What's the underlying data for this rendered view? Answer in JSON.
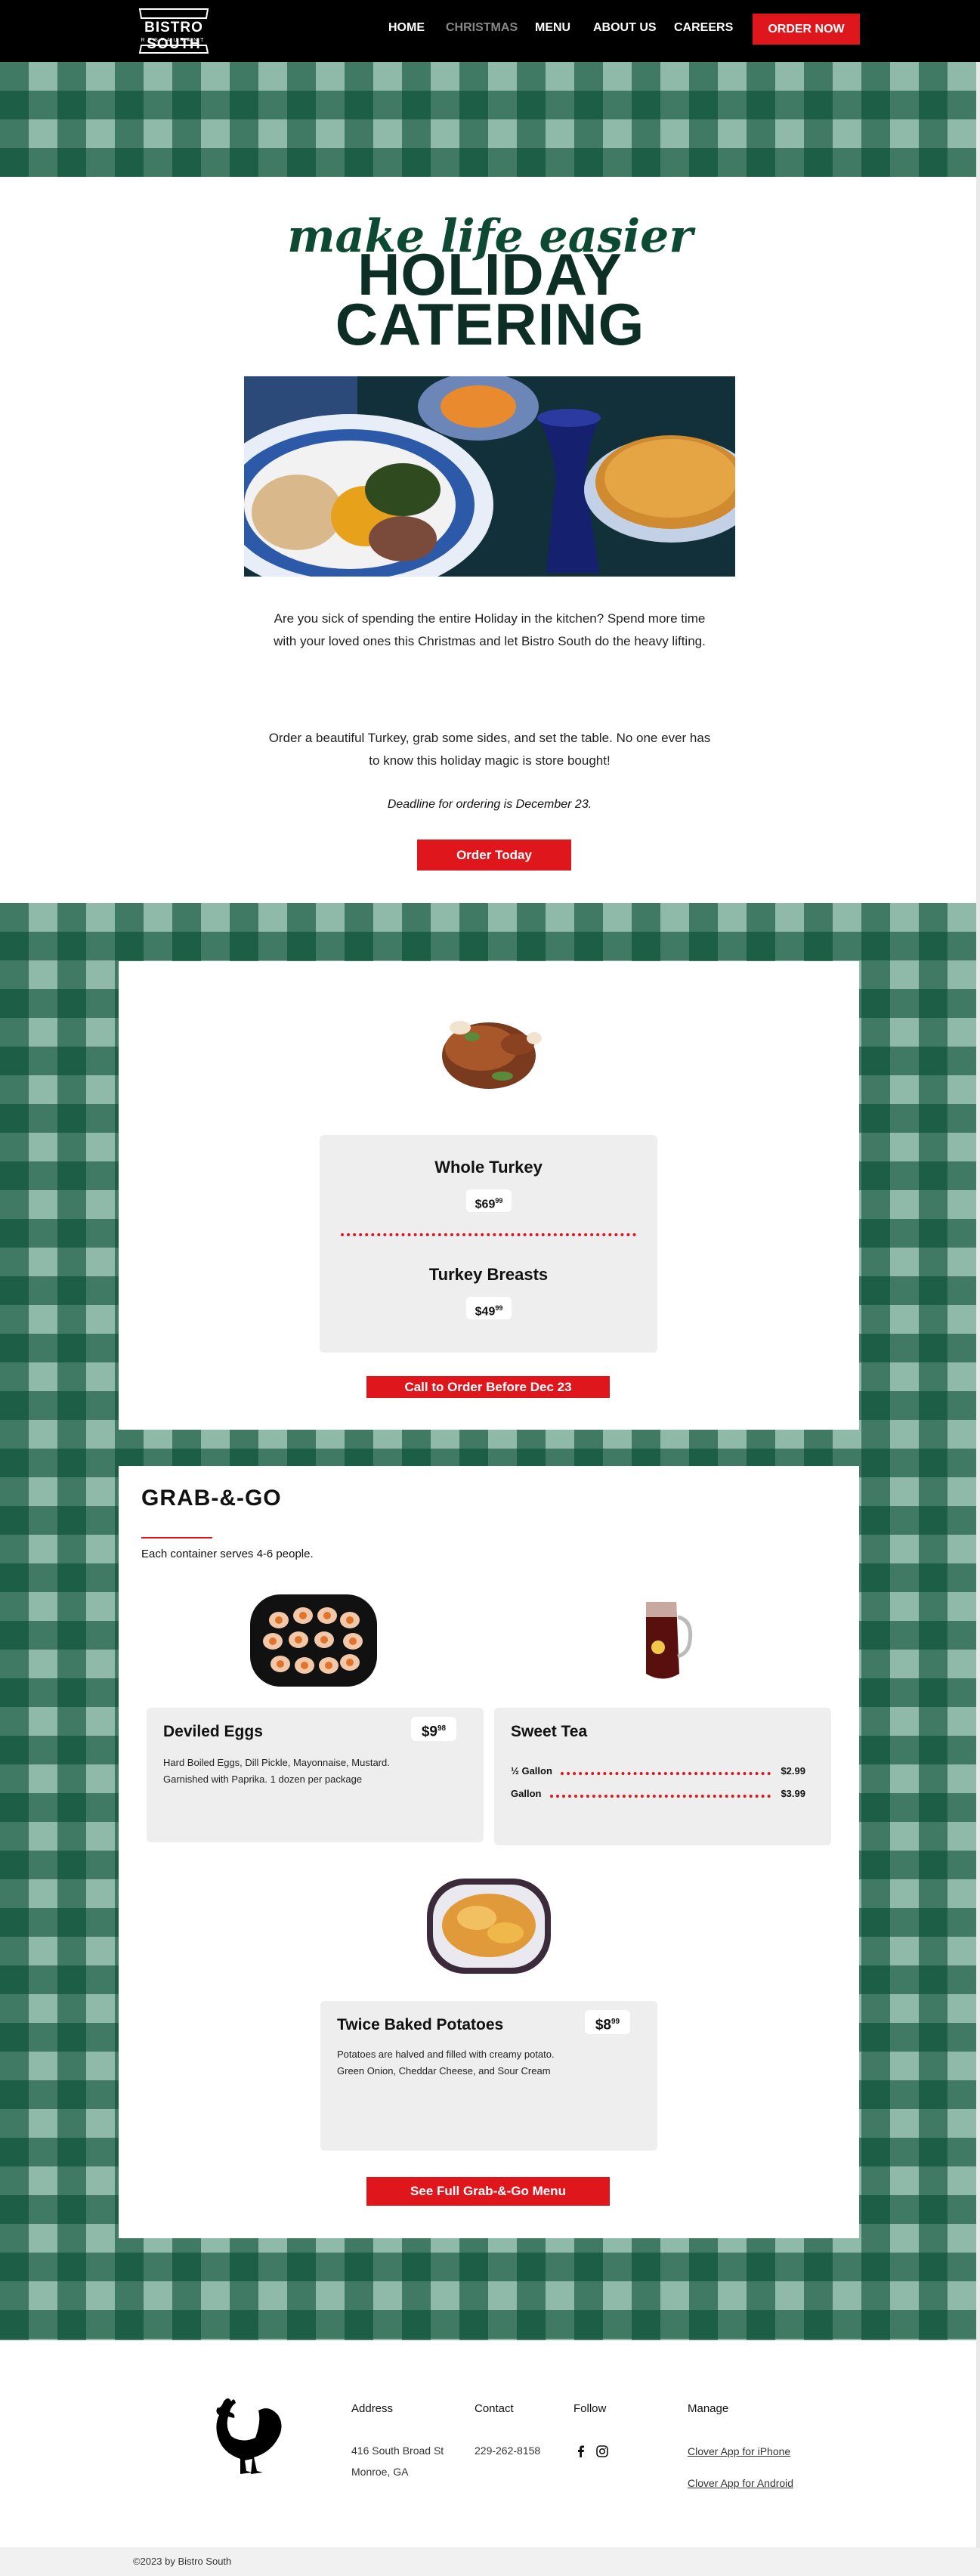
{
  "header": {
    "logo_name": "BISTRO SOUTH",
    "logo_sub": "RESTAURANT",
    "nav": [
      "HOME",
      "CHRISTMAS",
      "MENU",
      "ABOUT US",
      "CAREERS"
    ],
    "order_button": "ORDER NOW",
    "accent_color": "#e0161d"
  },
  "hero": {
    "script_title": "make life easier",
    "title_line1": "HOLIDAY",
    "title_line2": "CATERING",
    "paragraph1": "Are you sick of spending the entire Holiday in the kitchen? Spend more time with your loved ones this Christmas and let Bistro South do the heavy lifting.",
    "paragraph2": "Order a beautiful Turkey, grab some sides, and set the table. No one ever has to know this holiday magic is store bought!",
    "deadline": "Deadline for ordering is December 23.",
    "button": "Order Today"
  },
  "turkey": {
    "item1_name": "Whole Turkey",
    "item1_price": "$69",
    "item1_cents": "99",
    "item2_name": "Turkey Breasts",
    "item2_price": "$49",
    "item2_cents": "99",
    "button": "Call to Order Before Dec 23"
  },
  "grab_and_go": {
    "title": "GRAB-&-GO",
    "subtitle": "Each container serves 4-6 people.",
    "deviled_eggs": {
      "name": "Deviled Eggs",
      "price": "$9",
      "cents": "98",
      "desc1": "Hard Boiled Eggs, Dill Pickle, Mayonnaise, Mustard.",
      "desc2": "Garnished with Paprika. 1 dozen per package"
    },
    "sweet_tea": {
      "name": "Sweet Tea",
      "row1_label": "½ Gallon",
      "row1_price": "$2.99",
      "row2_label": "Gallon",
      "row2_price": "$3.99"
    },
    "potatoes": {
      "name": "Twice Baked Potatoes",
      "price": "$8",
      "cents": "99",
      "desc1": "Potatoes are halved and filled with creamy potato.",
      "desc2": "Green Onion, Cheddar Cheese, and Sour Cream"
    },
    "button": "See Full Grab-&-Go Menu"
  },
  "footer": {
    "address_label": "Address",
    "address_line1": "416 South Broad St",
    "address_line2": "Monroe, GA",
    "contact_label": "Contact",
    "phone": "229-262-8158",
    "follow_label": "Follow",
    "manage_label": "Manage",
    "link_iphone": "Clover App for iPhone",
    "link_android": "Clover App for Android",
    "copyright": "©2023 by Bistro South",
    "icons": [
      "facebook-icon",
      "instagram-icon",
      "rooster-logo"
    ]
  }
}
